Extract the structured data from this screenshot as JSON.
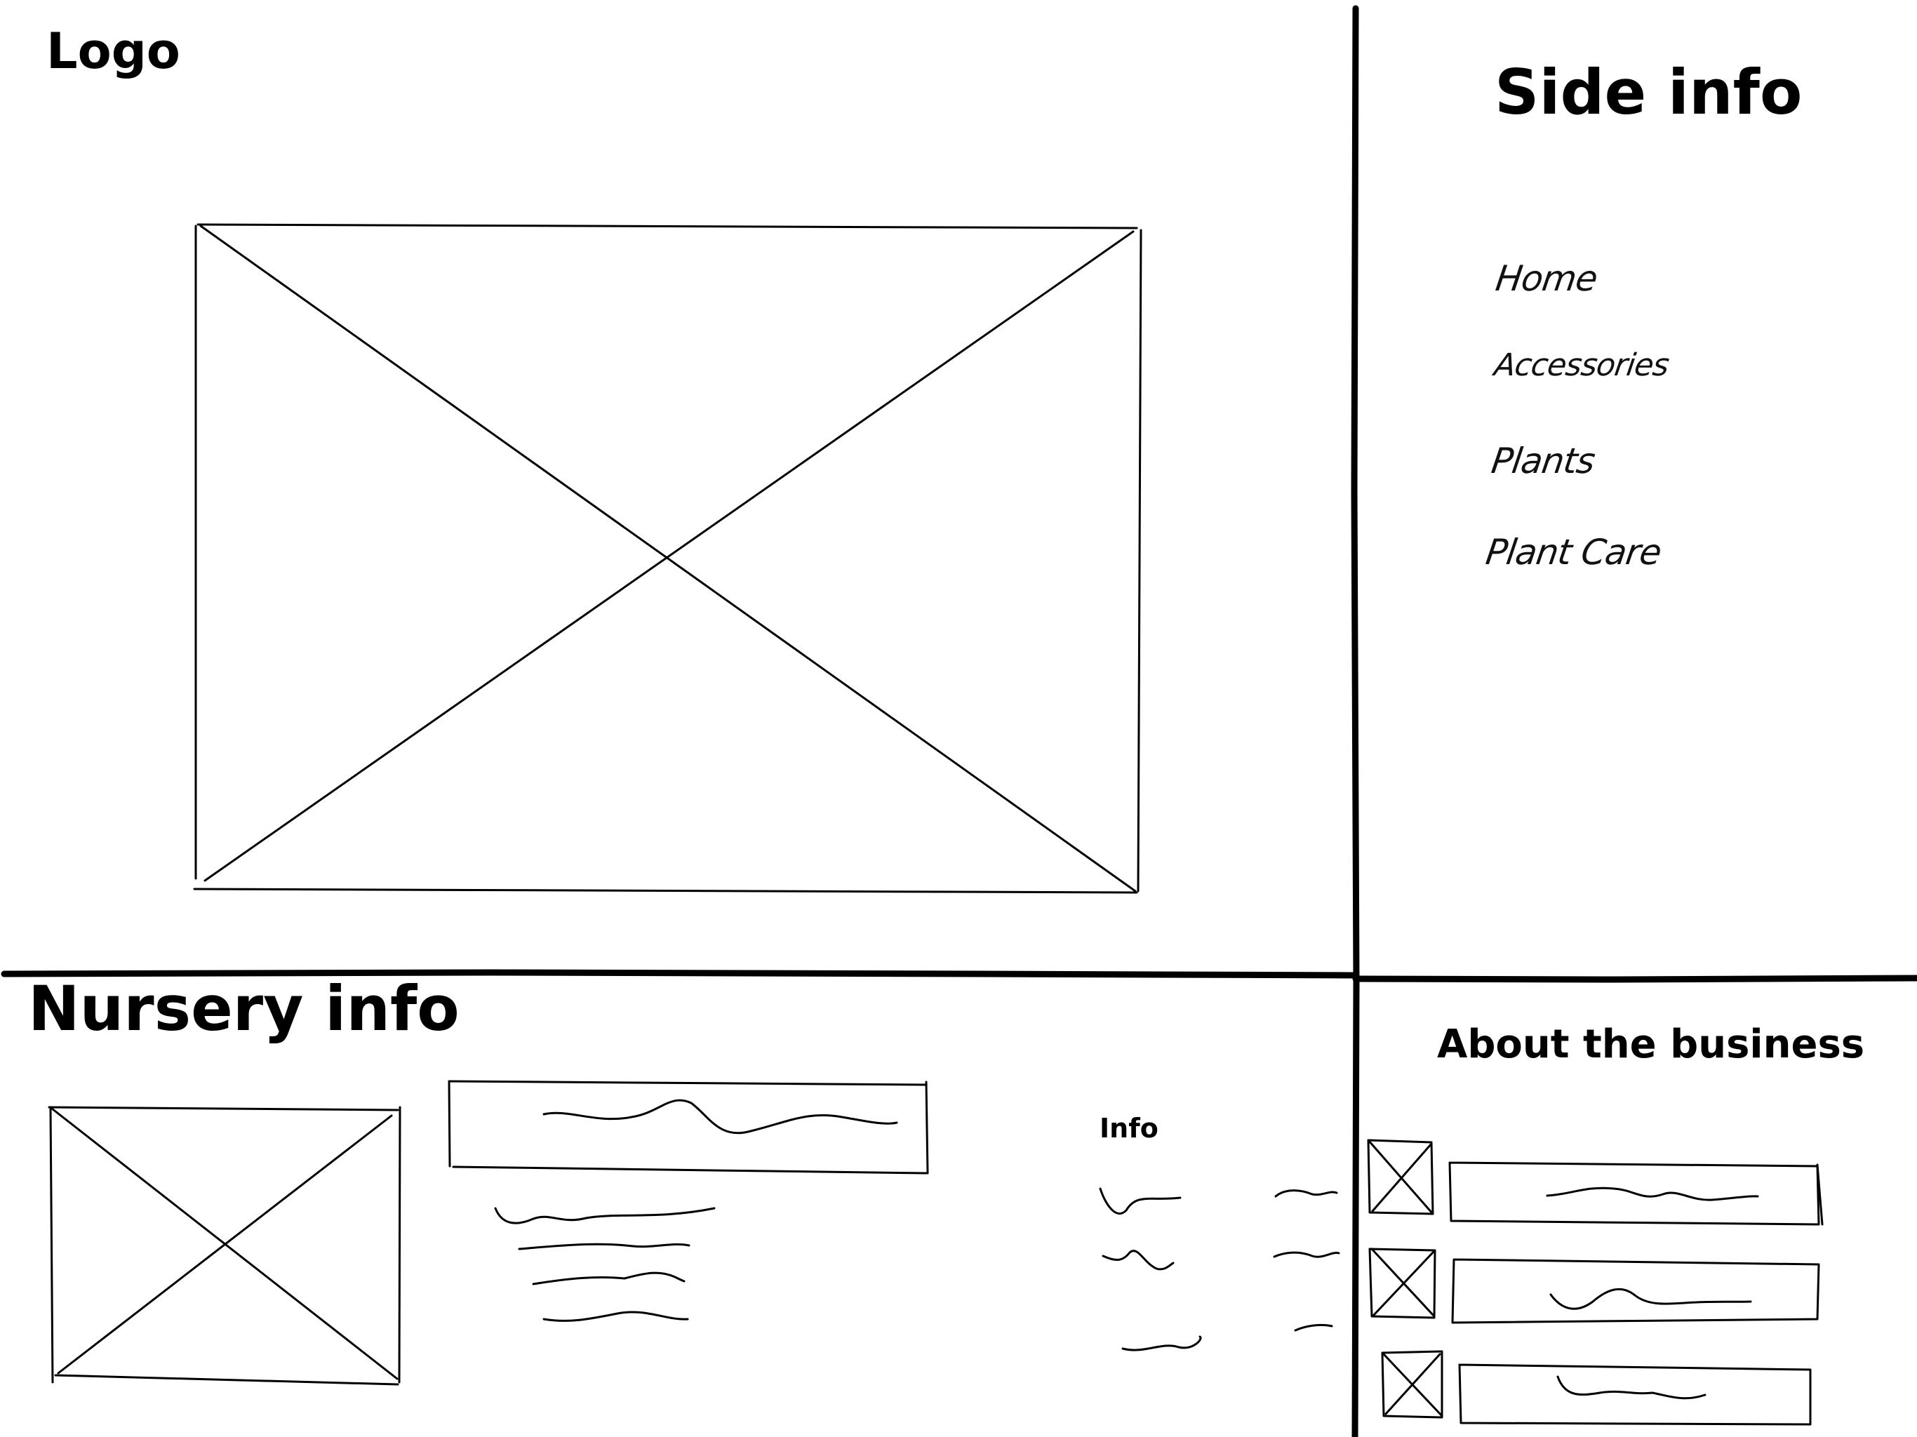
{
  "header": {
    "logo": "Logo"
  },
  "side": {
    "title": "Side info",
    "nav": [
      "Home",
      "Accessories",
      "Plants",
      "Plant Care"
    ]
  },
  "nursery": {
    "title": "Nursery info",
    "info_label": "Info"
  },
  "about": {
    "title": "About the business"
  }
}
